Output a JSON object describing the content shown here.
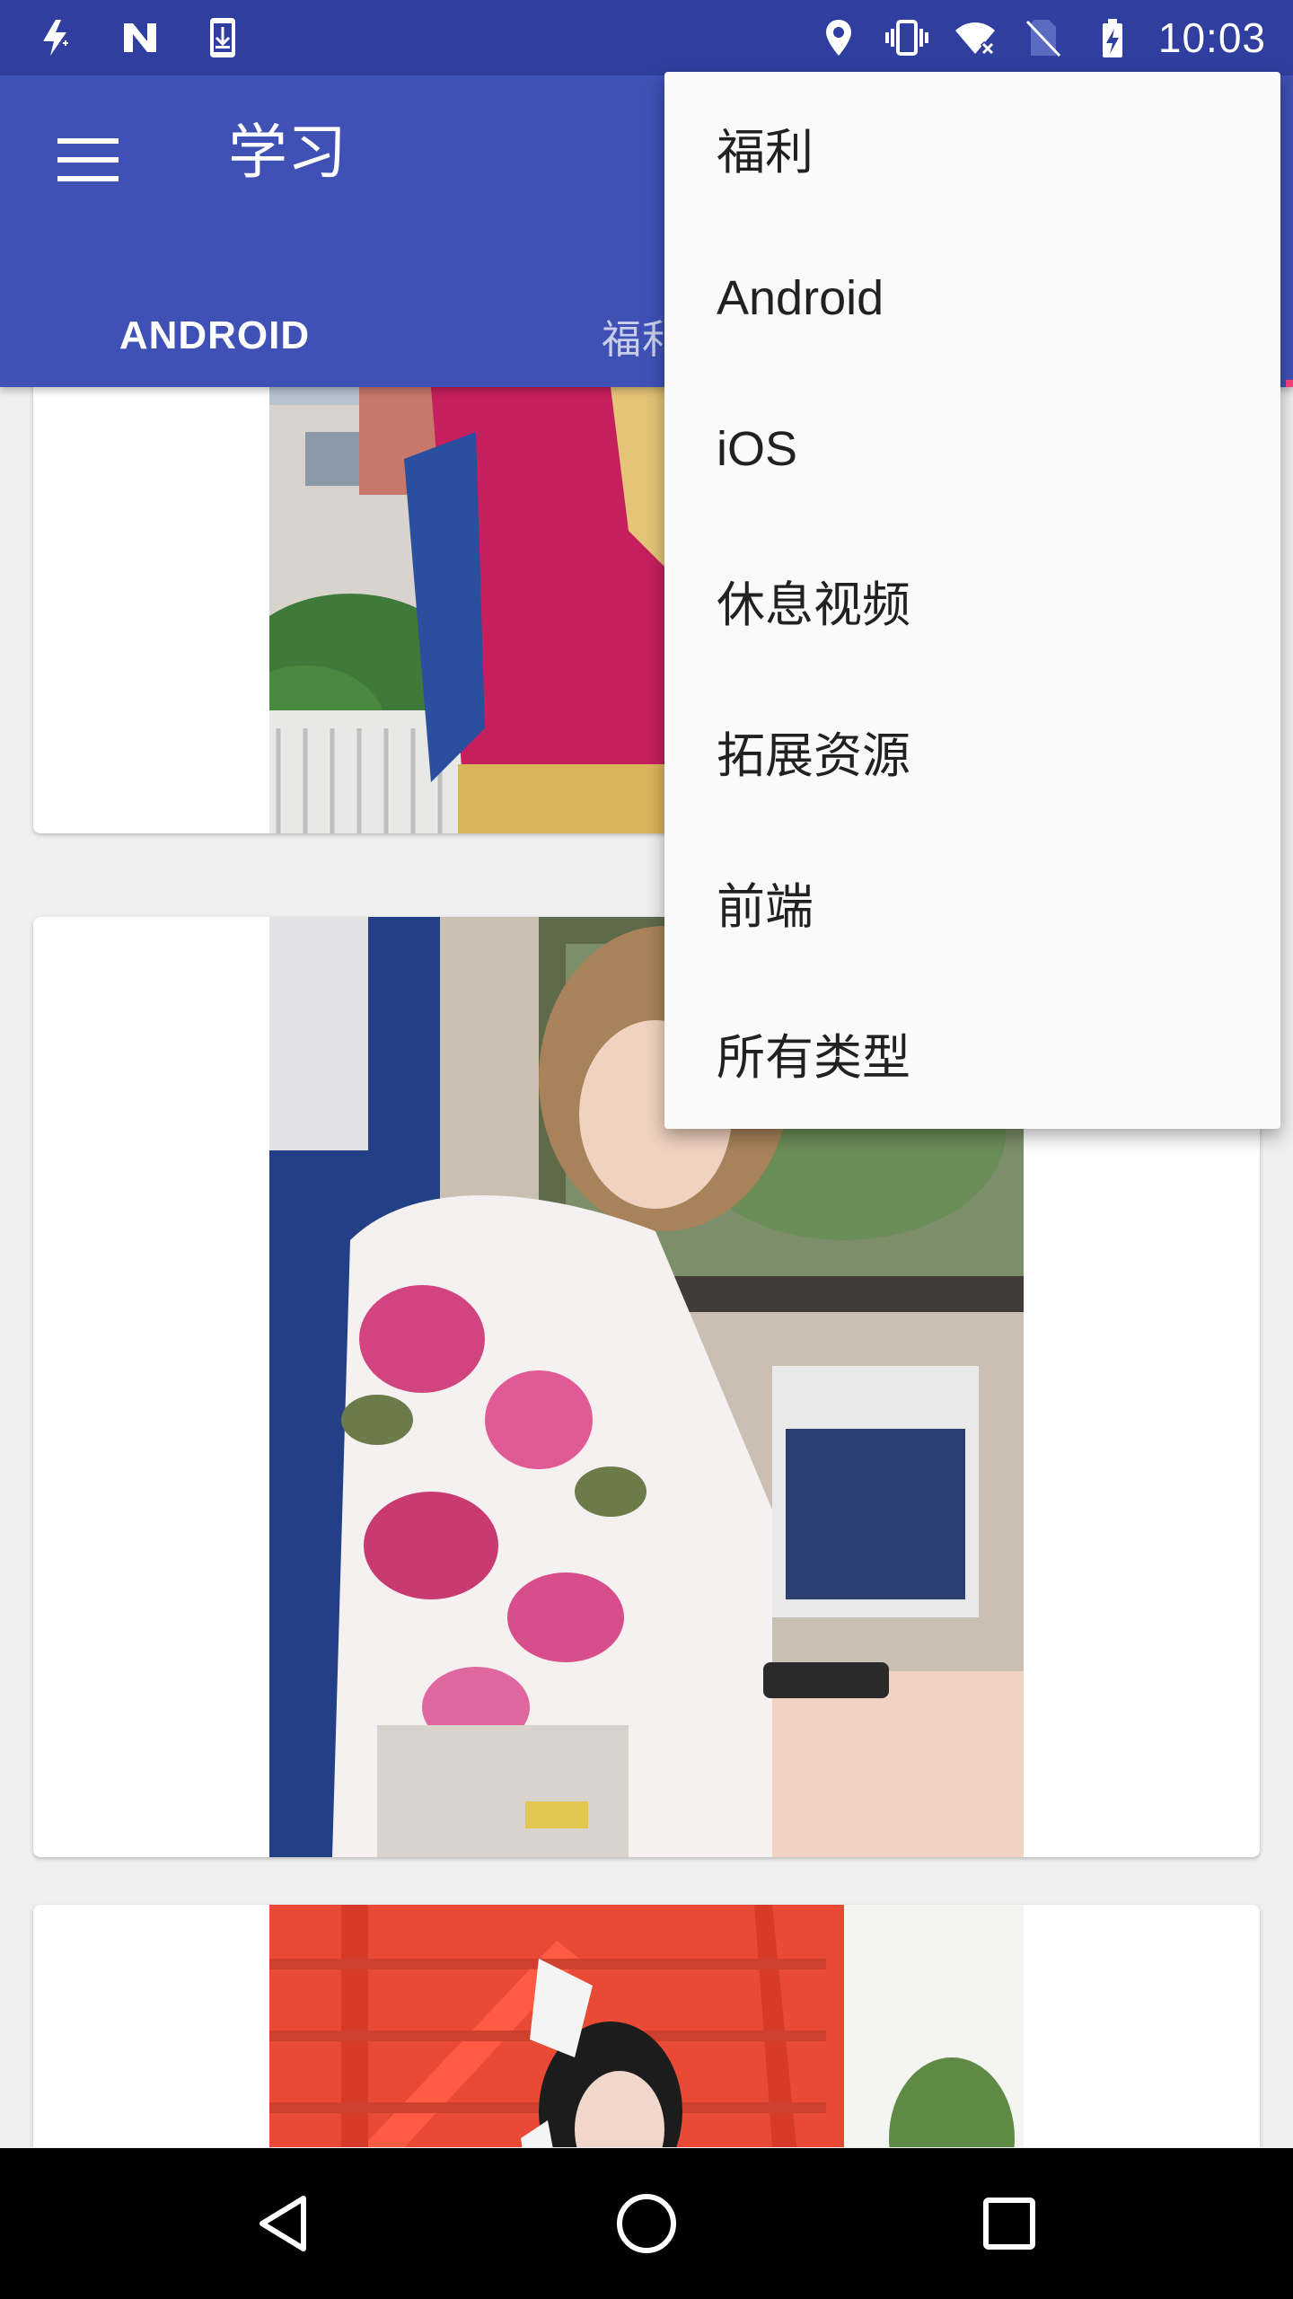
{
  "status_bar": {
    "time": "10:03",
    "left_icons": [
      "flash-auto-icon",
      "n-logo-icon",
      "download-phone-icon"
    ],
    "right_icons": [
      "location-pin-icon",
      "vibrate-icon",
      "wifi-off-icon",
      "no-sim-icon",
      "battery-charging-icon"
    ]
  },
  "app_bar": {
    "title": "学习",
    "color": "#3f51b5",
    "status_color": "#303f9f",
    "tabs": [
      {
        "label": "ANDROID",
        "selected": true
      },
      {
        "label": "福利",
        "selected": false
      }
    ],
    "indicator_color": "#ff4081"
  },
  "dropdown": {
    "items": [
      "福利",
      "Android",
      "iOS",
      "休息视频",
      "拓展资源",
      "前端",
      "所有类型"
    ]
  },
  "feed": {
    "cards": [
      {
        "image": "cosplay-red-costume-photo"
      },
      {
        "image": "girl-on-train-photo"
      },
      {
        "image": "girl-with-fox-mask-photo"
      }
    ]
  },
  "nav_bar": {
    "buttons": [
      "back-icon",
      "home-icon",
      "recents-icon"
    ]
  }
}
